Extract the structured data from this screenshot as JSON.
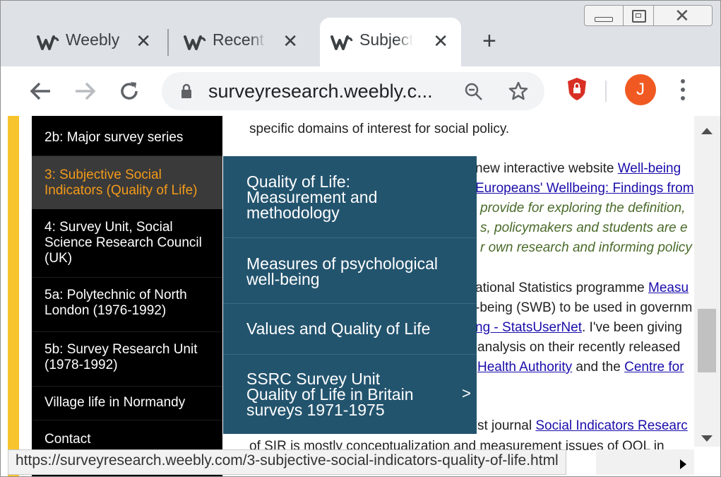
{
  "window_controls": {
    "minimize": "minimize",
    "restore": "restore",
    "close": "close"
  },
  "tabs": [
    {
      "label": "Weebly",
      "icon": "weebly-icon"
    },
    {
      "label": "Recent a",
      "icon": "weebly-icon"
    },
    {
      "label": "Subjecti",
      "icon": "weebly-icon"
    }
  ],
  "toolbar": {
    "url": "surveyresearch.weebly.c...",
    "avatar_letter": "J"
  },
  "sidebar": {
    "items": [
      {
        "label": "2b: Major survey series"
      },
      {
        "label": "3: Subjective Social Indicators (Quality of Life)"
      },
      {
        "label": "4: Survey Unit, Social Science Research Council (UK)"
      },
      {
        "label": "5a: Polytechnic of North London (1976-1992)"
      },
      {
        "label": "5b: Survey Research Unit (1978-1992)"
      },
      {
        "label": "Village life in Normandy"
      },
      {
        "label": "Contact"
      }
    ]
  },
  "submenu": {
    "items": [
      {
        "label": "Quality of Life: Measurement and methodology"
      },
      {
        "label": "Measures of psychological well-being"
      },
      {
        "label": "Values and Quality of Life"
      },
      {
        "label": "SSRC Survey Unit Quality of Life in Britain surveys 1971-1975",
        "arrow": ">"
      }
    ]
  },
  "page": {
    "line1": "specific domains of interest for social policy.",
    "line2_text": "new interactive website ",
    "line2_link": "Well-being",
    "line3_link": "Europeans' Wellbeing: Findings from",
    "line4": "provide for exploring the definition,",
    "line5": "s, policymakers and students are e",
    "line6": "r own research and informing policy",
    "line7_text": "ational Statistics programme ",
    "line7_link": "Measu",
    "line8": "-being (SWB) to be used in governm",
    "line9_link": "ng - StatsUserNet",
    "line9_text": ".   I've been giving",
    "line10": "analysis on their recently released",
    "line11_link1": "Health Authority",
    "line11_text": " and the ",
    "line11_link2": "Centre for",
    "line12_text": "st journal ",
    "line12_link": "Social Indicators Researc",
    "line13": "of SIR is mostly conceptualization and measurement issues of QOL in"
  },
  "status_url": "https://surveyresearch.weebly.com/3-subjective-social-indicators-quality-of-life.html"
}
